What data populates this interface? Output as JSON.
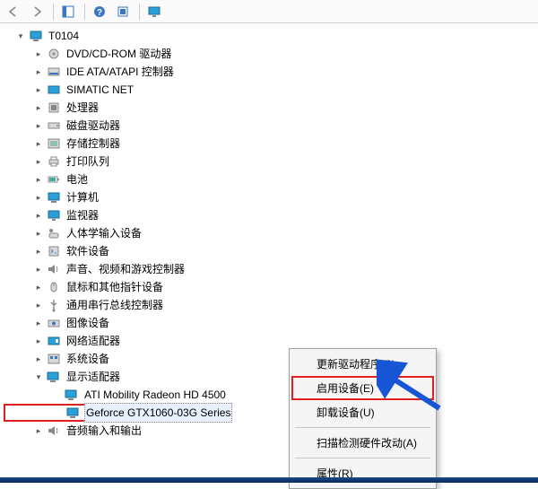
{
  "toolbar": {
    "back": "back-icon",
    "forward": "forward-icon",
    "views": "views-icon",
    "help": "help-icon",
    "scan": "scan-icon",
    "monitor": "monitor-icon"
  },
  "root": {
    "name": "T0104"
  },
  "categories": [
    {
      "label": "DVD/CD-ROM 驱动器",
      "icon": "dvd-drive-icon"
    },
    {
      "label": "IDE ATA/ATAPI 控制器",
      "icon": "ide-controller-icon"
    },
    {
      "label": "SIMATIC NET",
      "icon": "network-card-icon"
    },
    {
      "label": "处理器",
      "icon": "cpu-icon"
    },
    {
      "label": "磁盘驱动器",
      "icon": "disk-drive-icon"
    },
    {
      "label": "存储控制器",
      "icon": "storage-controller-icon"
    },
    {
      "label": "打印队列",
      "icon": "printer-icon"
    },
    {
      "label": "电池",
      "icon": "battery-icon"
    },
    {
      "label": "计算机",
      "icon": "computer-icon"
    },
    {
      "label": "监视器",
      "icon": "monitor-device-icon"
    },
    {
      "label": "人体学输入设备",
      "icon": "hid-icon"
    },
    {
      "label": "软件设备",
      "icon": "software-device-icon"
    },
    {
      "label": "声音、视频和游戏控制器",
      "icon": "sound-icon"
    },
    {
      "label": "鼠标和其他指针设备",
      "icon": "mouse-icon"
    },
    {
      "label": "通用串行总线控制器",
      "icon": "usb-icon"
    },
    {
      "label": "图像设备",
      "icon": "imaging-icon"
    },
    {
      "label": "网络适配器",
      "icon": "network-adapter-icon"
    },
    {
      "label": "系统设备",
      "icon": "system-device-icon"
    }
  ],
  "display_adapter": {
    "label": "显示适配器",
    "children": [
      {
        "label": "ATI Mobility Radeon HD 4500"
      },
      {
        "label": "Geforce GTX1060-03G Series"
      }
    ]
  },
  "audio": {
    "label": "音频输入和输出"
  },
  "context_menu": {
    "items": [
      "更新驱动程序(P)",
      "启用设备(E)",
      "卸载设备(U)",
      "扫描检测硬件改动(A)",
      "属性(R)"
    ]
  }
}
